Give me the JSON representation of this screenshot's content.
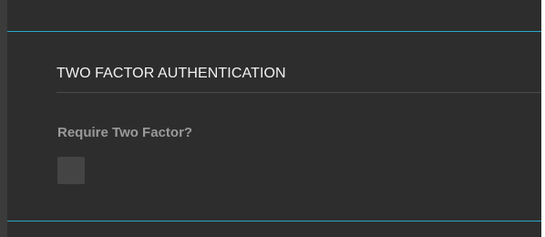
{
  "two_factor": {
    "section_title": "TWO FACTOR AUTHENTICATION",
    "require_label": "Require Two Factor?",
    "checked": false
  },
  "colors": {
    "panel_background": "#2d2d2d",
    "accent": "#2aa4c7",
    "checkbox_background": "#444444"
  }
}
